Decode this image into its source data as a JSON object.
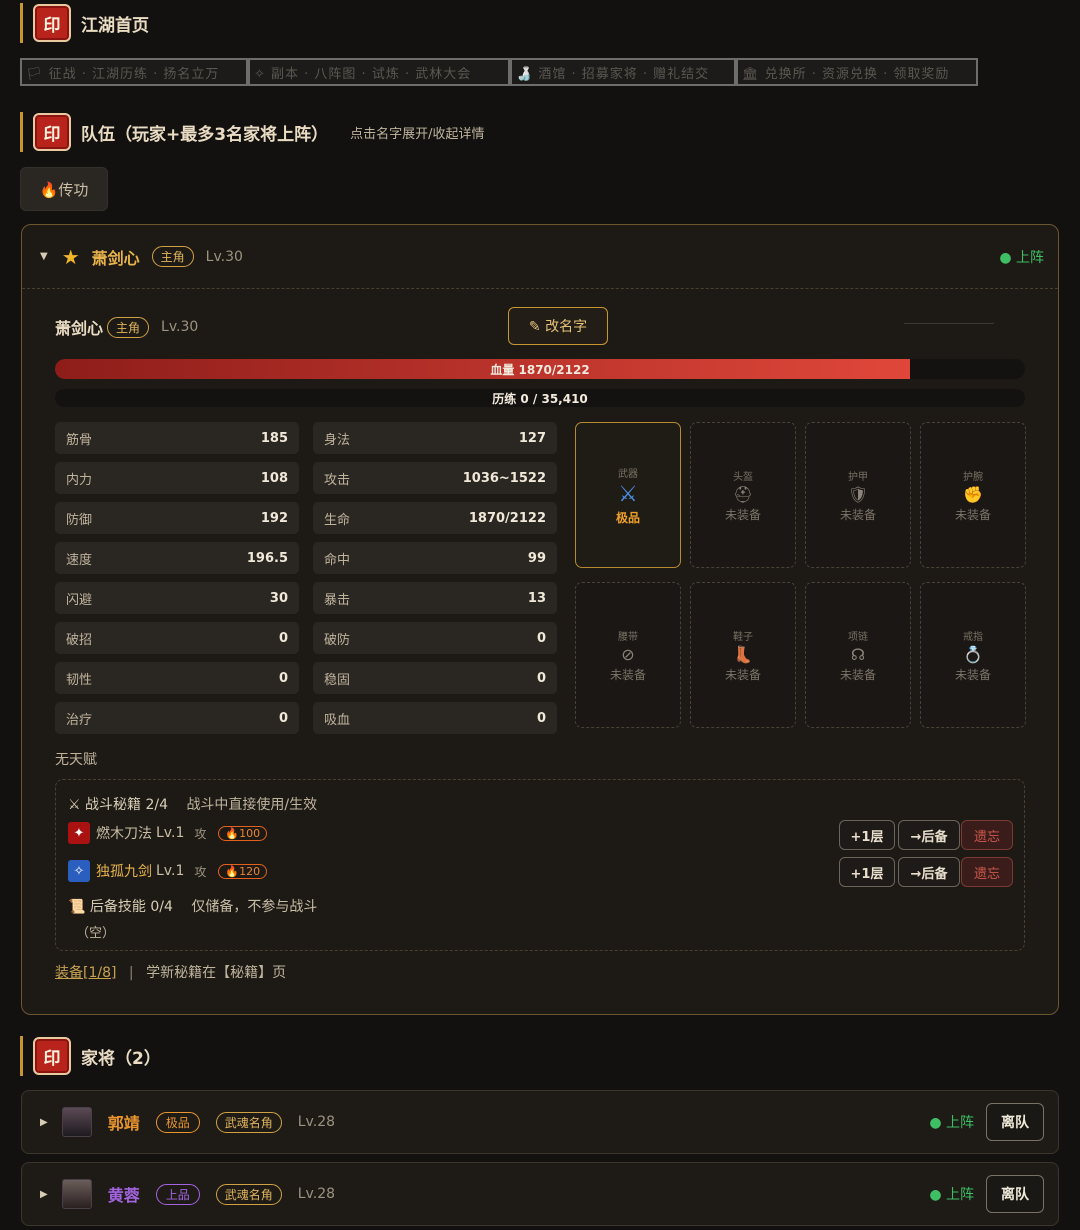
{
  "sections": {
    "home_title": "江湖首页",
    "seal_char": "印",
    "team_title": "队伍（玩家+最多3名家将上阵）",
    "team_sub": "点击名字展开/收起详情",
    "generals_title": "家将（2）"
  },
  "ticker": [
    "🏳 征战 · 江湖历练 · 扬名立万",
    "✧ 副本 · 八阵图 · 试炼 · 武林大会",
    "🍶 酒馆 · 招募家将 · 赠礼结交",
    "🏛 兑换所 · 资源兑换 · 领取奖励"
  ],
  "transmit_button": "🔥传功",
  "main_char": {
    "name": "萧剑心",
    "role_tag": "主角",
    "level": "Lv.30",
    "status": "● 上阵",
    "rename_button": "✎ 改名字",
    "hp_text": "血量 1870/2122",
    "hp_fraction": 0.881,
    "exp_text": "历练 0 / 35,410",
    "exp_fraction": 0
  },
  "stats": [
    {
      "k": "筋骨",
      "v": "185"
    },
    {
      "k": "身法",
      "v": "127"
    },
    {
      "k": "内力",
      "v": "108"
    },
    {
      "k": "攻击",
      "v": "1036~1522"
    },
    {
      "k": "防御",
      "v": "192"
    },
    {
      "k": "生命",
      "v": "1870/2122"
    },
    {
      "k": "速度",
      "v": "196.5"
    },
    {
      "k": "命中",
      "v": "99"
    },
    {
      "k": "闪避",
      "v": "30"
    },
    {
      "k": "暴击",
      "v": "13"
    },
    {
      "k": "破招",
      "v": "0"
    },
    {
      "k": "破防",
      "v": "0"
    },
    {
      "k": "韧性",
      "v": "0"
    },
    {
      "k": "稳固",
      "v": "0"
    },
    {
      "k": "治疗",
      "v": "0"
    },
    {
      "k": "吸血",
      "v": "0"
    }
  ],
  "equipment": [
    {
      "slot": "武器",
      "icon": "⚔",
      "state": "极品"
    },
    {
      "slot": "头盔",
      "icon": "⛑",
      "state": "未装备"
    },
    {
      "slot": "护甲",
      "icon": "🛡",
      "state": "未装备"
    },
    {
      "slot": "护腕",
      "icon": "✊",
      "state": "未装备"
    },
    {
      "slot": "腰带",
      "icon": "⊘",
      "state": "未装备"
    },
    {
      "slot": "鞋子",
      "icon": "👢",
      "state": "未装备"
    },
    {
      "slot": "项链",
      "icon": "☊",
      "state": "未装备"
    },
    {
      "slot": "戒指",
      "icon": "💍",
      "state": "未装备"
    }
  ],
  "talent": "无天赋",
  "skills": {
    "title": "⚔ 战斗秘籍 2/4",
    "title_note": "战斗中直接使用/生效",
    "list": [
      {
        "name": "燃木刀法",
        "level": "Lv.1",
        "type": "攻",
        "cost": "🔥100",
        "color": "#c22",
        "name_color": "#c9bda4"
      },
      {
        "name": "独孤九剑",
        "level": "Lv.1",
        "type": "攻",
        "cost": "🔥120",
        "color": "#2a5fc0",
        "name_color": "#e8b34a"
      }
    ],
    "btn_up": "+1层",
    "btn_backup": "→后备",
    "btn_forget": "遗忘",
    "backup_title": "📜 后备技能 0/4",
    "backup_note": "仅储备，不参与战斗",
    "backup_empty": "（空）"
  },
  "footer": {
    "equip_link": "装备[1/8]",
    "sep": "|",
    "learn_text": "学新秘籍在【秘籍】页"
  },
  "generals": [
    {
      "name": "郭靖",
      "quality": "极品",
      "quality_color": "#e8952e",
      "title": "武魂名角",
      "level": "Lv.28",
      "status": "● 上阵",
      "leave": "离队"
    },
    {
      "name": "黄蓉",
      "quality": "上品",
      "quality_color": "#a463e0",
      "title": "武魂名角",
      "level": "Lv.28",
      "status": "● 上阵",
      "leave": "离队"
    }
  ]
}
